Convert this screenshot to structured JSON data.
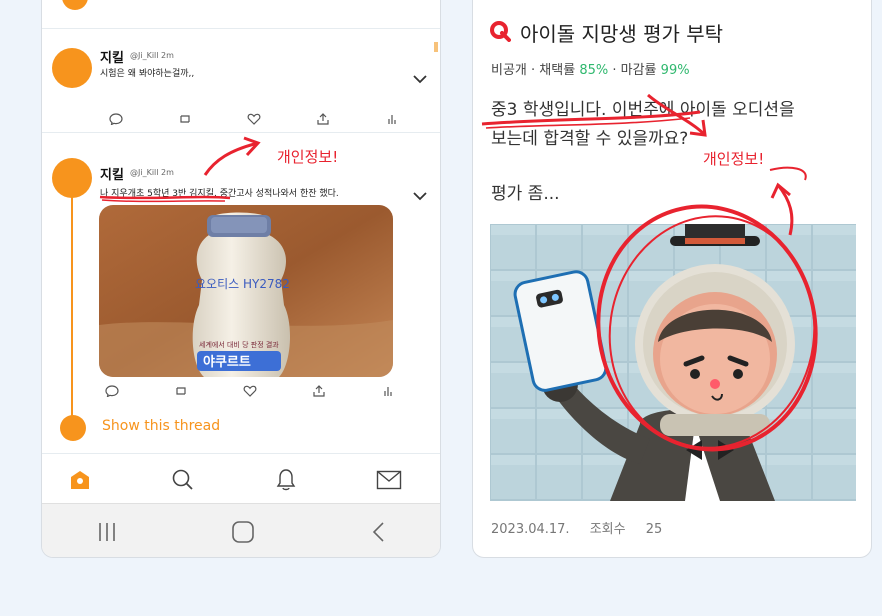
{
  "left_phone": {
    "tweets": [
      {
        "name": "지킬",
        "handle": "@Ji_Kill  2m",
        "text": "시험은 왜 봐야하는걸까,,"
      },
      {
        "name": "지킬",
        "handle": "@Ji_Kill  2m",
        "text": "나 지우개초 5학년 3반 김지킬. 중간고사 성적나와서 한잔 했다.",
        "photo_labels": {
          "brand_line": "요오티스 HY2782",
          "small_line": "세계에서 대비 당 판정 결과",
          "bottle_name": "야쿠르트"
        }
      }
    ],
    "annotation": "개인정보!",
    "show_thread": "Show this thread",
    "tab_icons": [
      "home-icon",
      "search-icon",
      "notifications-icon",
      "messages-icon"
    ],
    "nav_icons": [
      "recent-apps-icon",
      "home-nav-icon",
      "back-icon"
    ],
    "accent": "#f7941d"
  },
  "right_card": {
    "title": "아이돌 지망생 평가 부탁",
    "meta": {
      "visibility": "비공개",
      "adopt_label": "채택률",
      "adopt_value": "85%",
      "deadline_label": "마감률",
      "deadline_value": "99%"
    },
    "content_line1": "중3 학생입니다. 이번주에 아이돌 오디션을",
    "content_line2": "보는데 합격할 수 있을까요?",
    "content_line3": "평가 좀...",
    "annotation": "개인정보!",
    "footer": {
      "date": "2023.04.17.",
      "views_label": "조회수",
      "views_value": "25"
    },
    "accent": "#e8232f",
    "green": "#2fb86e"
  }
}
